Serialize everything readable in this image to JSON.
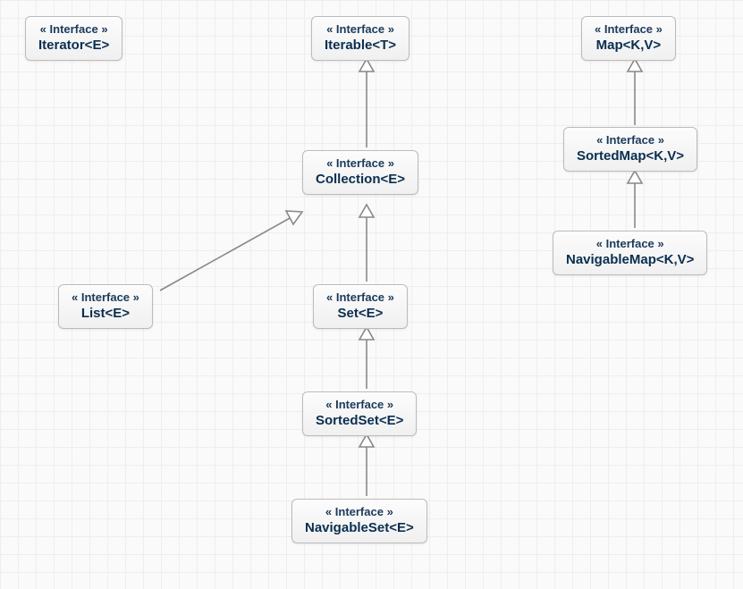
{
  "nodes": {
    "iterator": {
      "stereotype": "« Interface »",
      "name": "Iterator<E>"
    },
    "iterable": {
      "stereotype": "« Interface »",
      "name": "Iterable<T>"
    },
    "map": {
      "stereotype": "« Interface »",
      "name": "Map<K,V>"
    },
    "collection": {
      "stereotype": "« Interface »",
      "name": "Collection<E>"
    },
    "sortedmap": {
      "stereotype": "« Interface »",
      "name": "SortedMap<K,V>"
    },
    "navigablemap": {
      "stereotype": "« Interface »",
      "name": "NavigableMap<K,V>"
    },
    "list": {
      "stereotype": "« Interface »",
      "name": "List<E>"
    },
    "set": {
      "stereotype": "« Interface »",
      "name": "Set<E>"
    },
    "sortedset": {
      "stereotype": "« Interface »",
      "name": "SortedSet<E>"
    },
    "navigableset": {
      "stereotype": "« Interface »",
      "name": "NavigableSet<E>"
    }
  }
}
